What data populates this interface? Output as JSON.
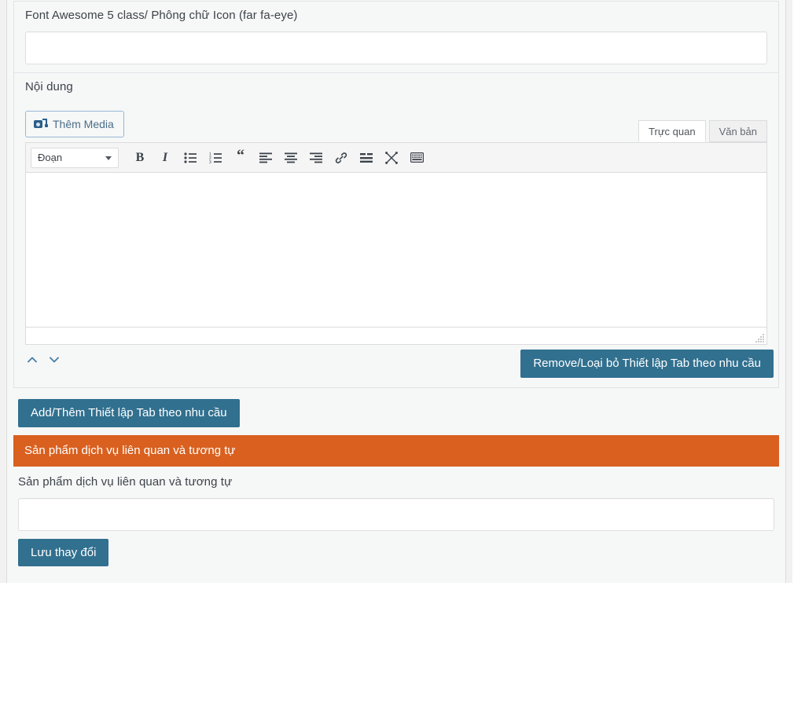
{
  "fields": {
    "icon_class": {
      "label": "Font Awesome 5 class/ Phông chữ Icon (far fa-eye)",
      "value": "",
      "placeholder": ""
    },
    "content": {
      "label": "Nội dung"
    }
  },
  "editor": {
    "add_media_label": "Thêm Media",
    "add_media_icon": "media-camera-music-icon",
    "tabs": [
      {
        "label": "Trực quan",
        "active": true
      },
      {
        "label": "Văn bản",
        "active": false
      }
    ],
    "format_select": {
      "value": "Đoạn",
      "caret_icon": "chevron-down-icon"
    },
    "toolbar_buttons": [
      {
        "name": "bold-button",
        "icon": "bold-icon",
        "glyph": "B"
      },
      {
        "name": "italic-button",
        "icon": "italic-icon",
        "glyph": "I"
      },
      {
        "name": "bulleted-list-button",
        "icon": "unordered-list-icon",
        "glyph": ""
      },
      {
        "name": "numbered-list-button",
        "icon": "ordered-list-icon",
        "glyph": ""
      },
      {
        "name": "blockquote-button",
        "icon": "quote-icon",
        "glyph": "“"
      },
      {
        "name": "align-left-button",
        "icon": "align-left-icon",
        "glyph": ""
      },
      {
        "name": "align-center-button",
        "icon": "align-center-icon",
        "glyph": ""
      },
      {
        "name": "align-right-button",
        "icon": "align-right-icon",
        "glyph": ""
      },
      {
        "name": "insert-link-button",
        "icon": "link-icon",
        "glyph": ""
      },
      {
        "name": "read-more-button",
        "icon": "read-more-icon",
        "glyph": ""
      },
      {
        "name": "fullscreen-button",
        "icon": "fullscreen-icon",
        "glyph": ""
      },
      {
        "name": "keyboard-shortcuts-button",
        "icon": "keyboard-icon",
        "glyph": ""
      }
    ],
    "body_text": ""
  },
  "group_controls": {
    "move_up_icon": "chevron-up-icon",
    "move_down_icon": "chevron-down-icon",
    "remove_label": "Remove/Loại bỏ Thiết lập Tab theo nhu cầu",
    "add_label": "Add/Thêm Thiết lập Tab theo nhu cầu"
  },
  "related_section": {
    "heading": "Sản phẩm dịch vụ liên quan và tương tự",
    "field_label": "Sản phẩm dịch vụ liên quan và tương tự",
    "field_value": "",
    "field_placeholder": ""
  },
  "footer": {
    "save_label": "Lưu thay đổi"
  },
  "colors": {
    "primary_blue": "#31708f",
    "accent_orange": "#d9601f",
    "admin_bg": "#f1f1f1",
    "panel_bg": "#f6f7f7",
    "border": "#dcdcde"
  }
}
